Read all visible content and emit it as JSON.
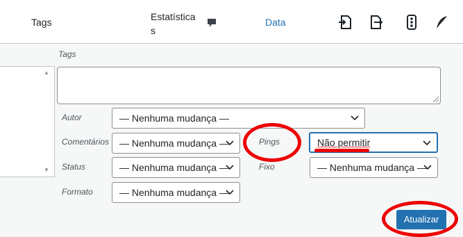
{
  "header": {
    "tags_label": "Tags",
    "stats_label": "Estatísticas",
    "date_label": "Data",
    "comment_icon": "comment-bubble-icon",
    "icons": [
      "import-page-icon",
      "export-page-icon",
      "traffic-light-icon",
      "feather-icon"
    ]
  },
  "editor": {
    "tags_label": "Tags",
    "fields": {
      "autor": {
        "label": "Autor",
        "value": "— Nenhuma mudança —"
      },
      "comentarios": {
        "label": "Comentários",
        "value": "— Nenhuma mudança —"
      },
      "pings": {
        "label": "Pings",
        "value": "Não permitir"
      },
      "status": {
        "label": "Status",
        "value": "— Nenhuma mudança —"
      },
      "fixo": {
        "label": "Fixo",
        "value": "— Nenhuma mudança —"
      },
      "formato": {
        "label": "Formato",
        "value": "— Nenhuma mudança —"
      }
    },
    "submit_label": "Atualizar"
  },
  "colors": {
    "accent": "#2271b1",
    "highlight": "#e00000"
  }
}
